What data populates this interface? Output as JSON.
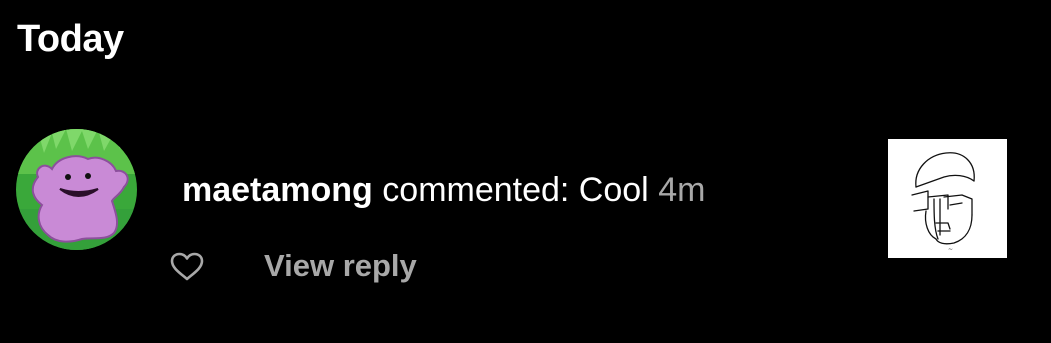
{
  "section": {
    "title": "Today"
  },
  "notification": {
    "username": "maetamong",
    "action_text": "commented: Cool",
    "timestamp": "4m",
    "view_reply_label": "View reply",
    "avatar_icon": "ditto-avatar-icon",
    "like_icon": "heart-outline-icon",
    "thumbnail_icon": "face-sketch-thumbnail"
  },
  "colors": {
    "background": "#000000",
    "primary_text": "#ffffff",
    "secondary_text": "#a8a8a8"
  }
}
